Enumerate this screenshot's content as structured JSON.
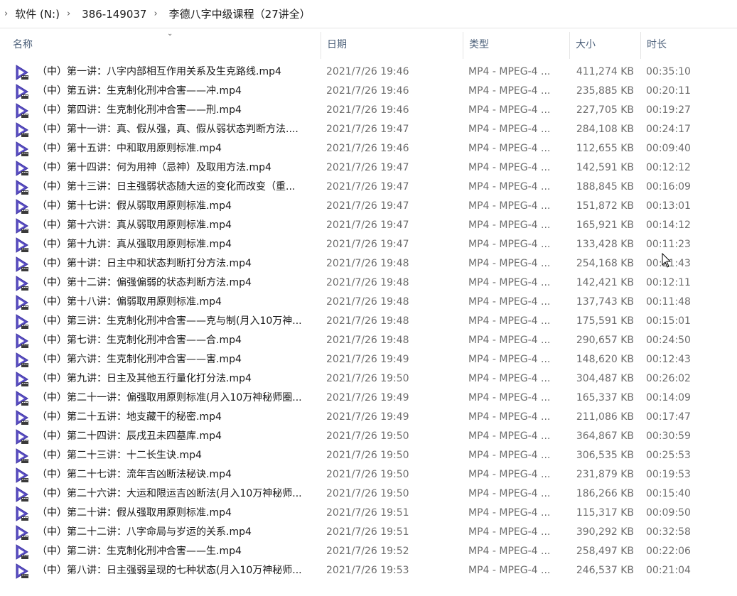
{
  "breadcrumb": {
    "items": [
      "软件 (N:)",
      "386-149037",
      "李德八字中级课程（27讲全）"
    ]
  },
  "columns": {
    "name": "名称",
    "date": "日期",
    "type": "类型",
    "size": "大小",
    "duration": "时长"
  },
  "files": [
    {
      "name": "（中）第一讲：八字内部相互作用关系及生克路线.mp4",
      "date": "2021/7/26 19:46",
      "type": "MP4 - MPEG-4 ...",
      "size": "411,274 KB",
      "duration": "00:35:10"
    },
    {
      "name": "（中）第五讲：生克制化刑冲合害——冲.mp4",
      "date": "2021/7/26 19:46",
      "type": "MP4 - MPEG-4 ...",
      "size": "235,885 KB",
      "duration": "00:20:11"
    },
    {
      "name": "（中）第四讲：生克制化刑冲合害——刑.mp4",
      "date": "2021/7/26 19:46",
      "type": "MP4 - MPEG-4 ...",
      "size": "227,705 KB",
      "duration": "00:19:27"
    },
    {
      "name": "（中）第十一讲：真、假从强，真、假从弱状态判断方法....",
      "date": "2021/7/26 19:47",
      "type": "MP4 - MPEG-4 ...",
      "size": "284,108 KB",
      "duration": "00:24:17"
    },
    {
      "name": "（中）第十五讲：中和取用原则标准.mp4",
      "date": "2021/7/26 19:46",
      "type": "MP4 - MPEG-4 ...",
      "size": "112,655 KB",
      "duration": "00:09:40"
    },
    {
      "name": "（中）第十四讲：何为用神（忌神）及取用方法.mp4",
      "date": "2021/7/26 19:47",
      "type": "MP4 - MPEG-4 ...",
      "size": "142,591 KB",
      "duration": "00:12:12"
    },
    {
      "name": "（中）第十三讲：日主强弱状态随大运的变化而改变（重...",
      "date": "2021/7/26 19:47",
      "type": "MP4 - MPEG-4 ...",
      "size": "188,845 KB",
      "duration": "00:16:09"
    },
    {
      "name": "（中）第十七讲：假从弱取用原则标准.mp4",
      "date": "2021/7/26 19:47",
      "type": "MP4 - MPEG-4 ...",
      "size": "151,872 KB",
      "duration": "00:13:01"
    },
    {
      "name": "（中）第十六讲：真从弱取用原则标准.mp4",
      "date": "2021/7/26 19:47",
      "type": "MP4 - MPEG-4 ...",
      "size": "165,921 KB",
      "duration": "00:14:12"
    },
    {
      "name": "（中）第十九讲：真从强取用原则标准.mp4",
      "date": "2021/7/26 19:47",
      "type": "MP4 - MPEG-4 ...",
      "size": "133,428 KB",
      "duration": "00:11:23"
    },
    {
      "name": "（中）第十讲：日主中和状态判断打分方法.mp4",
      "date": "2021/7/26 19:48",
      "type": "MP4 - MPEG-4 ...",
      "size": "254,168 KB",
      "duration": "00:21:43"
    },
    {
      "name": "（中）第十二讲：偏强偏弱的状态判断方法.mp4",
      "date": "2021/7/26 19:48",
      "type": "MP4 - MPEG-4 ...",
      "size": "142,421 KB",
      "duration": "00:12:11"
    },
    {
      "name": "（中）第十八讲：偏弱取用原则标准.mp4",
      "date": "2021/7/26 19:48",
      "type": "MP4 - MPEG-4 ...",
      "size": "137,743 KB",
      "duration": "00:11:48"
    },
    {
      "name": "（中）第三讲：生克制化刑冲合害——克与制(月入10万神...",
      "date": "2021/7/26 19:48",
      "type": "MP4 - MPEG-4 ...",
      "size": "175,591 KB",
      "duration": "00:15:01"
    },
    {
      "name": "（中）第七讲：生克制化刑冲合害——合.mp4",
      "date": "2021/7/26 19:48",
      "type": "MP4 - MPEG-4 ...",
      "size": "290,657 KB",
      "duration": "00:24:50"
    },
    {
      "name": "（中）第六讲：生克制化刑冲合害——害.mp4",
      "date": "2021/7/26 19:49",
      "type": "MP4 - MPEG-4 ...",
      "size": "148,620 KB",
      "duration": "00:12:43"
    },
    {
      "name": "（中）第九讲：日主及其他五行量化打分法.mp4",
      "date": "2021/7/26 19:50",
      "type": "MP4 - MPEG-4 ...",
      "size": "304,487 KB",
      "duration": "00:26:02"
    },
    {
      "name": "（中）第二十一讲：偏强取用原则标准(月入10万神秘师圈...",
      "date": "2021/7/26 19:49",
      "type": "MP4 - MPEG-4 ...",
      "size": "165,337 KB",
      "duration": "00:14:09"
    },
    {
      "name": "（中）第二十五讲：地支藏干的秘密.mp4",
      "date": "2021/7/26 19:49",
      "type": "MP4 - MPEG-4 ...",
      "size": "211,086 KB",
      "duration": "00:17:47"
    },
    {
      "name": "（中）第二十四讲：辰戌丑未四墓库.mp4",
      "date": "2021/7/26 19:50",
      "type": "MP4 - MPEG-4 ...",
      "size": "364,867 KB",
      "duration": "00:30:59"
    },
    {
      "name": "（中）第二十三讲：十二长生诀.mp4",
      "date": "2021/7/26 19:50",
      "type": "MP4 - MPEG-4 ...",
      "size": "306,535 KB",
      "duration": "00:25:53"
    },
    {
      "name": "（中）第二十七讲：流年吉凶断法秘诀.mp4",
      "date": "2021/7/26 19:50",
      "type": "MP4 - MPEG-4 ...",
      "size": "231,879 KB",
      "duration": "00:19:53"
    },
    {
      "name": "（中）第二十六讲：大运和限运吉凶断法(月入10万神秘师...",
      "date": "2021/7/26 19:50",
      "type": "MP4 - MPEG-4 ...",
      "size": "186,266 KB",
      "duration": "00:15:40"
    },
    {
      "name": "（中）第二十讲：假从强取用原则标准.mp4",
      "date": "2021/7/26 19:51",
      "type": "MP4 - MPEG-4 ...",
      "size": "115,317 KB",
      "duration": "00:09:50"
    },
    {
      "name": "（中）第二十二讲：八字命局与岁运的关系.mp4",
      "date": "2021/7/26 19:51",
      "type": "MP4 - MPEG-4 ...",
      "size": "390,292 KB",
      "duration": "00:32:58"
    },
    {
      "name": "（中）第二讲：生克制化刑冲合害——生.mp4",
      "date": "2021/7/26 19:52",
      "type": "MP4 - MPEG-4 ...",
      "size": "258,497 KB",
      "duration": "00:22:06"
    },
    {
      "name": "（中）第八讲：日主强弱呈现的七种状态(月入10万神秘师...",
      "date": "2021/7/26 19:53",
      "type": "MP4 - MPEG-4 ...",
      "size": "246,537 KB",
      "duration": "00:21:04"
    }
  ],
  "icons": {
    "file": "video-file-icon",
    "separator": "chevron-right-icon",
    "sort": "sort-down-icon",
    "cursor": "mouse-pointer-icon"
  },
  "colors": {
    "header_text": "#4c607a",
    "icon_fill": "#5b4fc4"
  }
}
